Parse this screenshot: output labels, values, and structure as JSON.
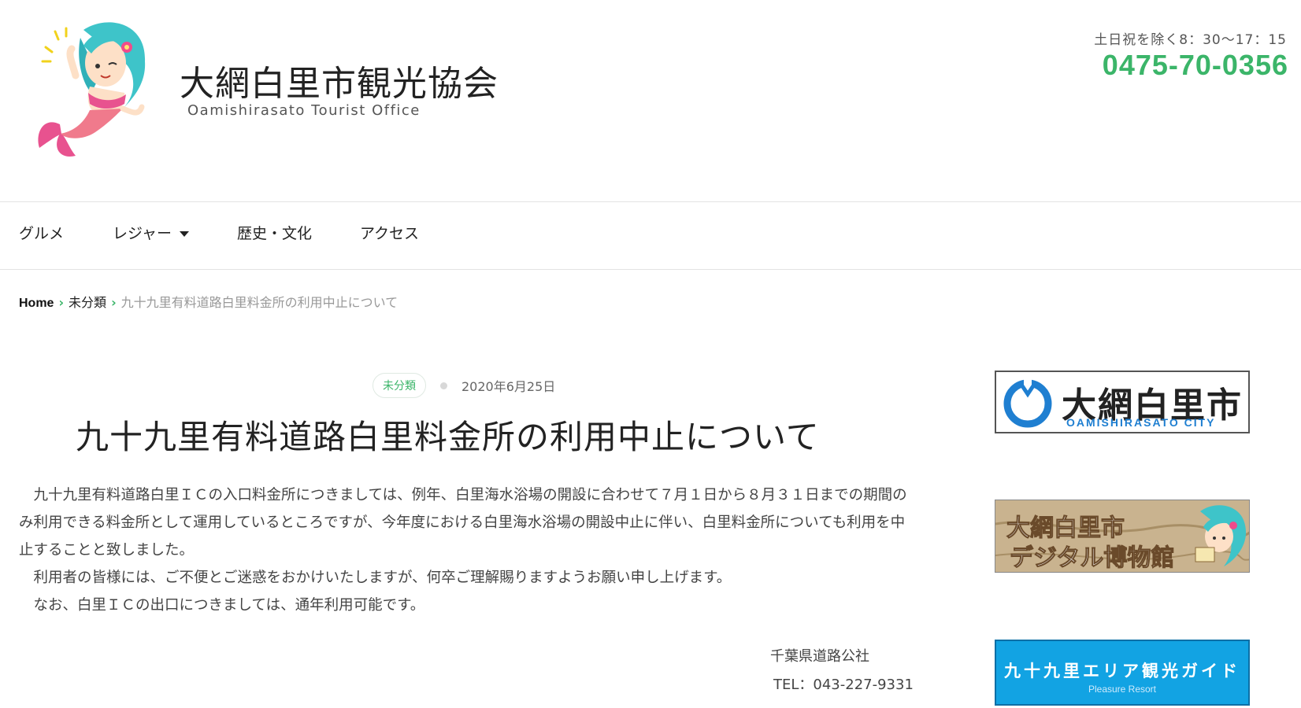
{
  "header": {
    "site_title": "大網白里市観光協会",
    "site_subtitle": "Oamishirasato Tourist Office",
    "hours": "土日祝を除く8：30〜17：15",
    "phone": "0475-70-0356"
  },
  "nav": {
    "items": [
      {
        "label": "グルメ"
      },
      {
        "label": "レジャー"
      },
      {
        "label": "歴史・文化"
      },
      {
        "label": "アクセス"
      }
    ]
  },
  "breadcrumb": {
    "home": "Home",
    "category": "未分類",
    "current": "九十九里有料道路白里料金所の利用中止について"
  },
  "article": {
    "category": "未分類",
    "date": "2020年6月25日",
    "title": "九十九里有料道路白里料金所の利用中止について",
    "paragraphs": [
      "　九十九里有料道路白里ＩＣの入口料金所につきましては、例年、白里海水浴場の開設に合わせて７月１日から８月３１日までの期間のみ利用できる料金所として運用しているところですが、今年度における白里海水浴場の開設中止に伴い、白里料金所についても利用を中止することと致しました。",
      "　利用者の皆様には、ご不便とご迷惑をおかけいたしますが、何卒ご理解賜りますようお願い申し上げます。",
      "　なお、白里ＩＣの出口につきましては、通年利用可能です。"
    ],
    "signature_org": "千葉県道路公社",
    "signature_tel": "TEL：043-227-9331"
  },
  "sidebar": {
    "banner1_title": "大網白里市",
    "banner1_sub": "OAMISHIRASATO CITY",
    "banner2_line1": "大網白里市",
    "banner2_line2": "デジタル博物館",
    "banner3_title": "九十九里エリア観光ガイド",
    "banner3_sub": "Pleasure Resort"
  },
  "colors": {
    "accent_green": "#3bb569",
    "banner_blue": "#12a3e3"
  }
}
